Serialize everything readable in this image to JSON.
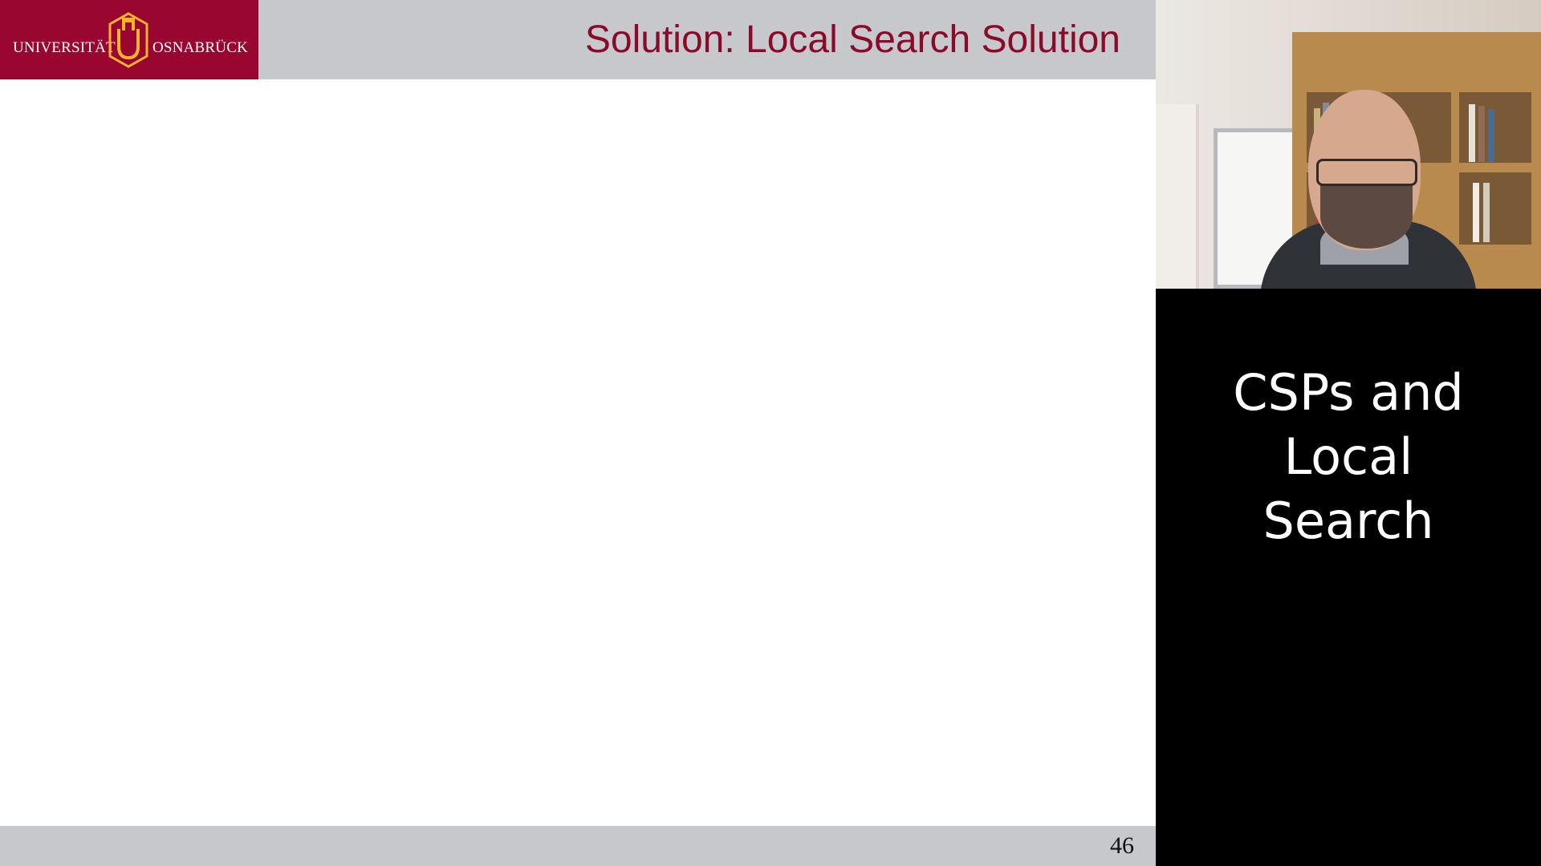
{
  "slide": {
    "logo": {
      "left": "UNIVERSITÄT",
      "right": "OSNABRÜCK"
    },
    "title": "Solution: Local Search Solution",
    "page_number": "46"
  },
  "webcam": {
    "icon": "person-video-feed"
  },
  "overlay": {
    "title_lines": [
      "CSPs and",
      "Local",
      "Search"
    ]
  },
  "colors": {
    "brand": "#990630",
    "title": "#8b0a2a",
    "header_bg": "#c7c8cc"
  }
}
